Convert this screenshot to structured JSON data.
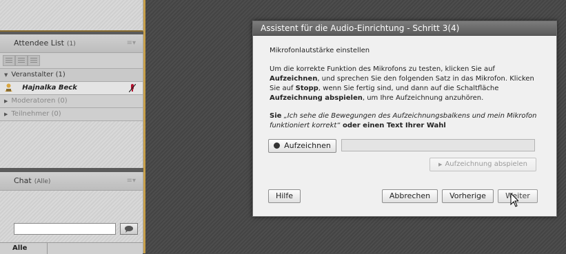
{
  "attendee_pod": {
    "title": "Attendee List",
    "count": "(1)",
    "menu": "≡▾",
    "sections": [
      {
        "label": "Veranstalter (1)",
        "state": "expanded"
      },
      {
        "label": "Moderatoren (0)",
        "state": "collapsed"
      },
      {
        "label": "Teilnehmer (0)",
        "state": "collapsed"
      }
    ],
    "host_user": {
      "name": "Hajnalka Beck",
      "icon": "host-user-icon",
      "mic_icon": "mic-disabled-icon"
    }
  },
  "chat_pod": {
    "title": "Chat",
    "scope": "(Alle)",
    "menu": "≡▾",
    "send_icon": "speech-bubble-icon",
    "footer_tab": "Alle"
  },
  "dialog": {
    "title": "Assistent für die Audio-Einrichtung - Schritt 3(4)",
    "subtitle": "Mikrofonlautstärke einstellen",
    "instr": {
      "t1": "Um die korrekte Funktion des Mikrofons zu testen, klicken Sie auf ",
      "b1": "Aufzeichnen",
      "t2": ", und sprechen Sie den folgenden Satz in das Mikrofon. Klicken Sie auf ",
      "b2": "Stopp",
      "t3": ", wenn Sie fertig sind, und dann auf die Schaltfläche ",
      "b3": "Aufzeichnung abspielen",
      "t4": ", um Ihre Aufzeichnung anzuhören."
    },
    "phrase": {
      "lead": "Sie",
      "quote": " „Ich sehe die Bewegungen des Aufzeichnungsbalkens und mein Mikrofon funktioniert korrekt“",
      "tail": " oder einen Text Ihrer Wahl"
    },
    "record_button": "Aufzeichnen",
    "play_button": "Aufzeichnung abspielen",
    "level": 0,
    "help_button": "Hilfe",
    "cancel_button": "Abbrechen",
    "prev_button": "Vorherige",
    "next_button": "Weiter"
  },
  "colors": {
    "accent_border": "#c8a04a",
    "dialog_title_bg": "#6a6a6a",
    "mic_off": "#b5122f"
  }
}
